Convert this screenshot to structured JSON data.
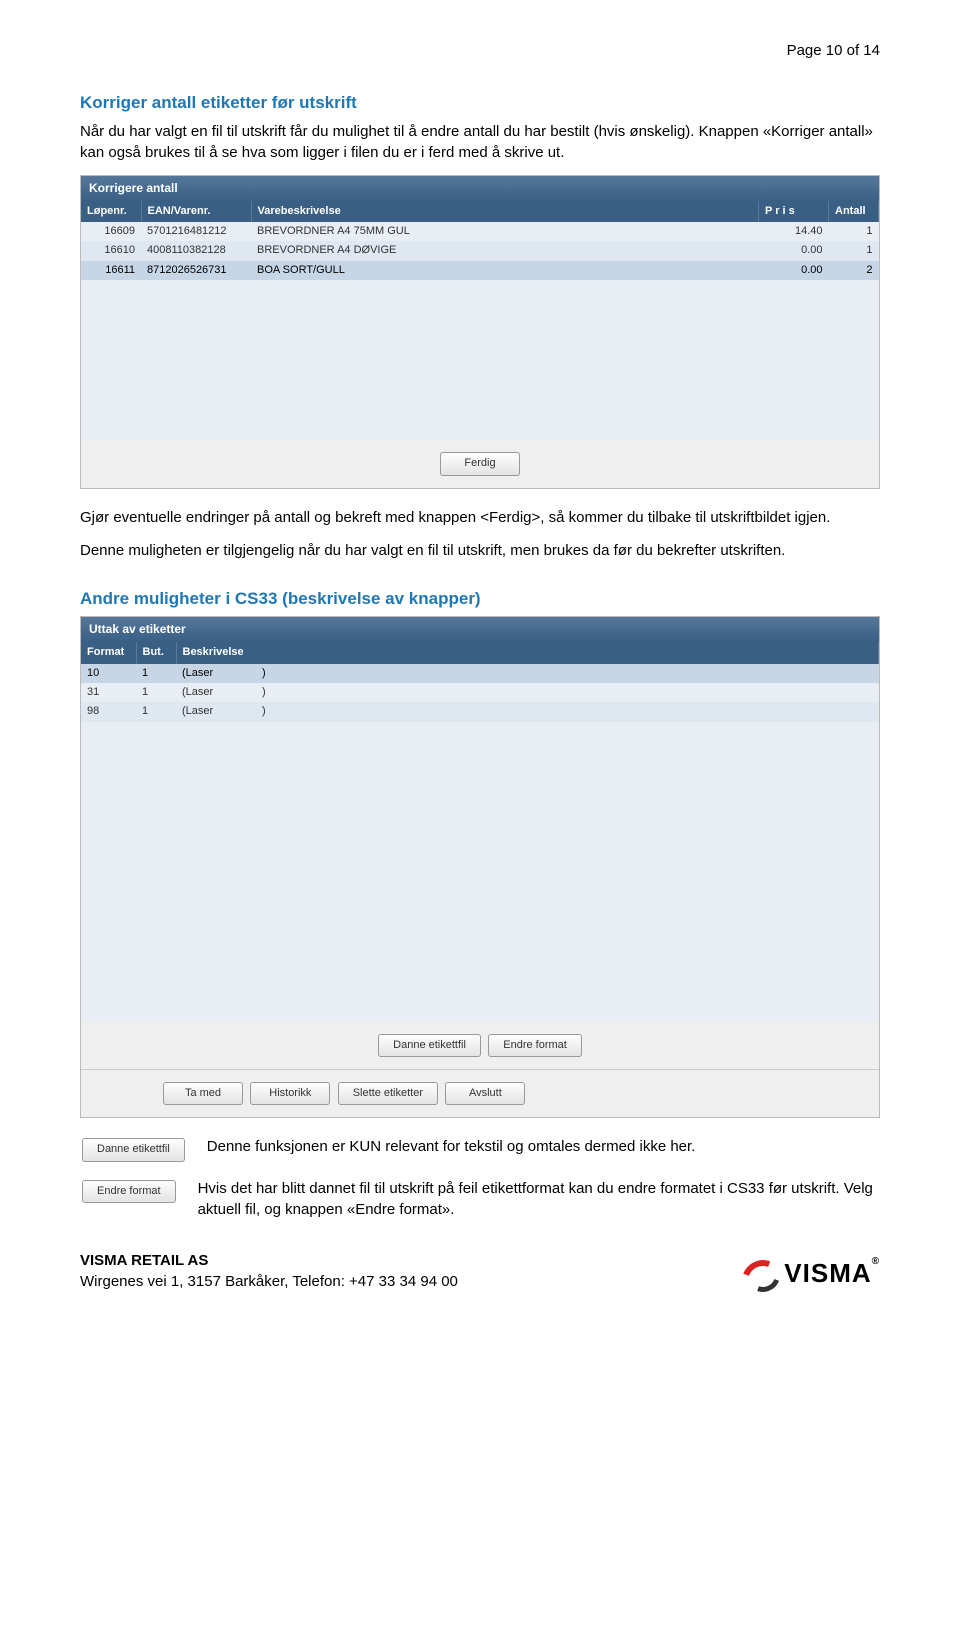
{
  "page_label": "Page 10 of 14",
  "sec1_title": "Korriger antall etiketter før utskrift",
  "sec1_p": "Når du har valgt en fil til utskrift får du mulighet til å endre antall du har bestilt (hvis ønskelig). Knappen «Korriger antall» kan også brukes til å se hva som ligger i filen du er i ferd med å skrive ut.",
  "panel1_title": "Korrigere antall",
  "panel1_cols": {
    "c1": "Løpenr.",
    "c2": "EAN/Varenr.",
    "c3": "Varebeskrivelse",
    "c4": "P r i s",
    "c5": "Antall"
  },
  "panel1_rows": [
    {
      "c1": "16609",
      "c2": "5701216481212",
      "c3": "BREVORDNER A4 75MM GUL",
      "c4": "14.40",
      "c5": "1"
    },
    {
      "c1": "16610",
      "c2": "4008110382128",
      "c3": "BREVORDNER A4 DØVIGE",
      "c4": "0.00",
      "c5": "1"
    },
    {
      "c1": "16611",
      "c2": "8712026526731",
      "c3": "BOA SORT/GULL",
      "c4": "0.00",
      "c5": "2"
    }
  ],
  "btn_ferdig": "Ferdig",
  "sec1_p2": "Gjør eventuelle endringer på antall og bekreft med knappen <Ferdig>, så kommer du tilbake til utskriftbildet igjen.",
  "sec1_p3": "Denne muligheten er tilgjengelig når du har valgt en fil til utskrift, men brukes da før du bekrefter utskriften.",
  "sec2_title": "Andre muligheter i CS33 (beskrivelse av knapper)",
  "panel2_title": "Uttak av etiketter",
  "panel2_cols": {
    "c1": "Format",
    "c2": "But.",
    "c3": "Beskrivelse"
  },
  "panel2_rows": [
    {
      "c1": "10",
      "c2": "1",
      "c3l": "(Laser",
      "c3r": ")"
    },
    {
      "c1": "31",
      "c2": "1",
      "c3l": "(Laser",
      "c3r": ")"
    },
    {
      "c1": "98",
      "c2": "1",
      "c3l": "(Laser",
      "c3r": ")"
    }
  ],
  "btns2a": {
    "b1": "Danne etikettfil",
    "b2": "Endre format"
  },
  "btns2b": {
    "b1": "Ta med",
    "b2": "Historikk",
    "b3": "Slette etiketter",
    "b4": "Avslutt"
  },
  "info1_btn": "Danne etikettfil",
  "info1_text": "Denne funksjonen er KUN relevant for tekstil og omtales dermed ikke her.",
  "info2_btn": "Endre format",
  "info2_text": "Hvis det har blitt dannet fil til utskrift på feil etikettformat kan du endre formatet i CS33 før utskrift. Velg aktuell fil, og knappen «Endre format».",
  "footer": {
    "company": "VISMA RETAIL AS",
    "address": "Wirgenes vei 1, 3157 Barkåker, Telefon: +47 33 34 94 00",
    "logo_text": "VISMA"
  }
}
